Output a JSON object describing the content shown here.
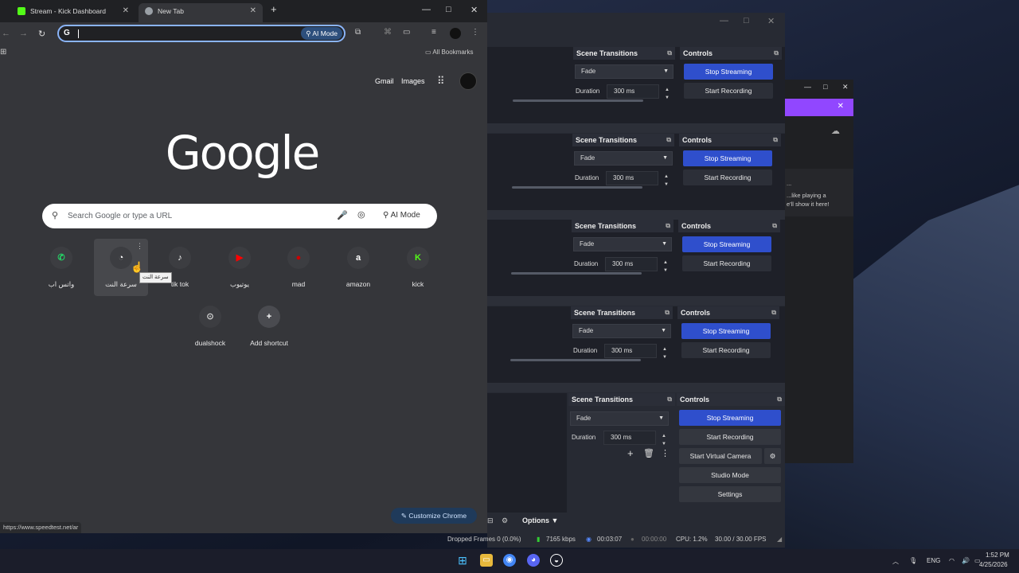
{
  "chrome": {
    "tabs": [
      {
        "label": "Stream - Kick Dashboard",
        "color": "#53fc18"
      },
      {
        "label": "New Tab",
        "color": "#9aa0a6"
      }
    ],
    "ai_mode_label": "AI Mode",
    "bookmarks_label": "All Bookmarks",
    "gmail_label": "Gmail",
    "images_label": "Images",
    "logo_text": "Google",
    "search_placeholder": "Search Google or type a URL",
    "search_ai_label": "AI Mode",
    "shortcuts": [
      {
        "label": "واتس اب",
        "icon": "whatsapp-icon",
        "glyph": "✆",
        "color": "#25d366"
      },
      {
        "label": "سرعة النت",
        "icon": "speedometer-icon",
        "glyph": "◔",
        "color": "#ffffff"
      },
      {
        "label": "tik tok",
        "icon": "tiktok-icon",
        "glyph": "♪",
        "color": "#ffffff"
      },
      {
        "label": "يوتيوب",
        "icon": "youtube-icon",
        "glyph": "▶",
        "color": "#ff0000"
      },
      {
        "label": "mad",
        "icon": "mad-icon",
        "glyph": "●",
        "color": "#cc0000"
      },
      {
        "label": "amazon",
        "icon": "amazon-icon",
        "glyph": "a",
        "color": "#ffffff"
      },
      {
        "label": "kick",
        "icon": "kick-icon",
        "glyph": "K",
        "color": "#53fc18"
      },
      {
        "label": "dualshock",
        "icon": "gamepad-icon",
        "glyph": "⊙",
        "color": "#cccccc"
      },
      {
        "label": "Add shortcut",
        "icon": "plus-icon",
        "glyph": "+",
        "color": "#ffffff"
      }
    ],
    "tooltip": "سرعة النت",
    "customize_label": "Customize Chrome",
    "status_url": "https://www.speedtest.net/ar"
  },
  "obs": {
    "scene_transitions_label": "Scene Transitions",
    "controls_label": "Controls",
    "transition": "Fade",
    "duration_label": "Duration",
    "duration_value": "300 ms",
    "stop_streaming": "Stop Streaming",
    "start_recording": "Start Recording",
    "start_virtual_camera": "Start Virtual Camera",
    "studio_mode": "Studio Mode",
    "settings": "Settings",
    "options_label": "Options",
    "status": {
      "dropped": "Dropped Frames 0 (0.0%)",
      "kbps": "7165 kbps",
      "live_time": "00:03:07",
      "rec_time": "00:00:00",
      "cpu": "CPU: 1.2%",
      "fps": "30.00 / 30.00 FPS"
    }
  },
  "kick": {
    "line1": "...",
    "line2": "...like playing a",
    "line3": "e'll show it here!"
  },
  "taskbar": {
    "lang": "ENG",
    "time": "1:52 PM",
    "date": "4/25/2026"
  }
}
